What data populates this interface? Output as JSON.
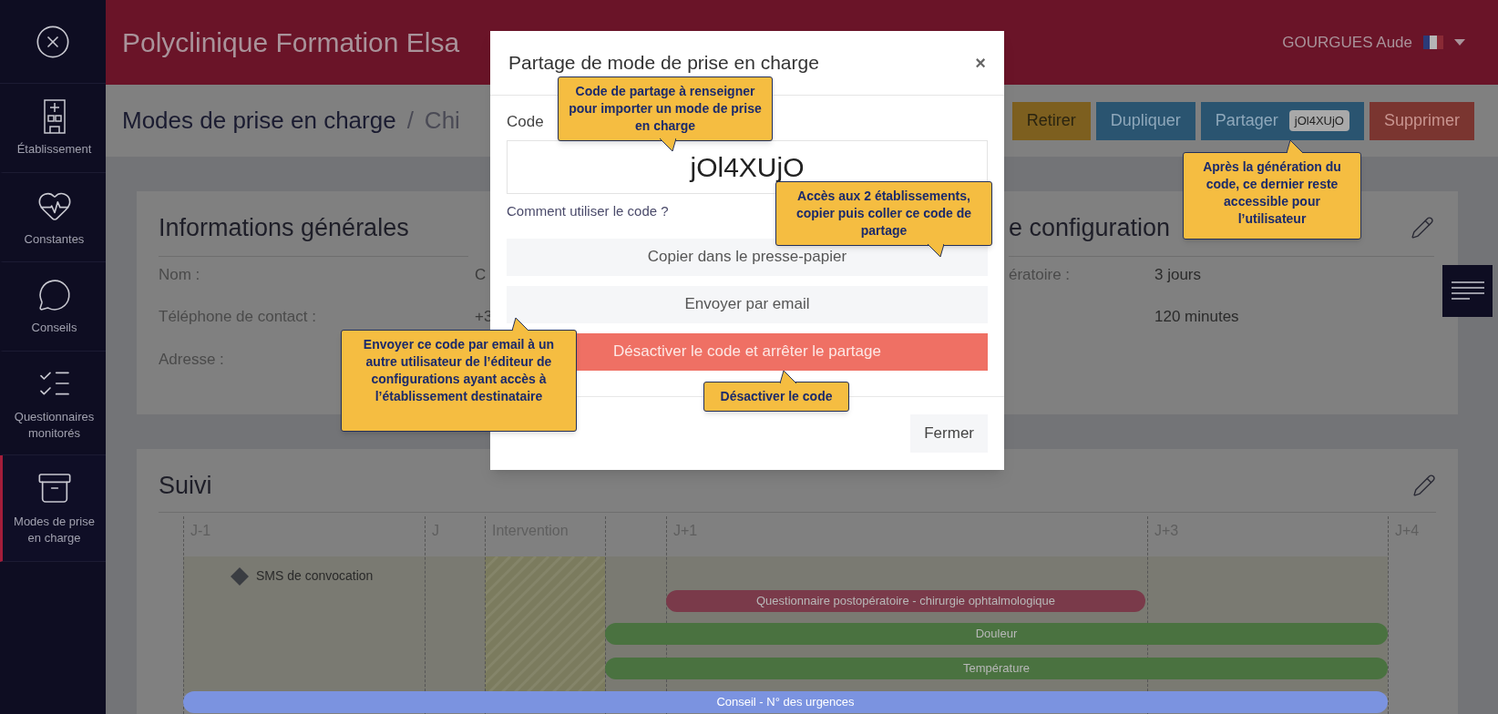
{
  "sidebar": {
    "items": [
      {
        "label": "Établissement",
        "selected": false
      },
      {
        "label": "Constantes",
        "selected": false
      },
      {
        "label": "Conseils",
        "selected": false
      },
      {
        "label": "Questionnaires monitorés",
        "selected": false
      },
      {
        "label": "Modes de prise en charge",
        "selected": true
      }
    ]
  },
  "header": {
    "title": "Polyclinique Formation Elsa",
    "user": "GOURGUES Aude"
  },
  "page": {
    "breadcrumb": [
      "Modes de prise en charge",
      "/",
      "Chi"
    ],
    "actions": [
      {
        "label": "Retirer",
        "kind": "warning"
      },
      {
        "label": "Dupliquer",
        "kind": "primary"
      },
      {
        "label": "Partager",
        "kind": "primary",
        "badge": "jOl4XUjO"
      },
      {
        "label": "Supprimer",
        "kind": "danger"
      }
    ]
  },
  "general_card": {
    "title": "Informations générales",
    "fields": [
      {
        "label": "Nom :",
        "value": "C"
      },
      {
        "label": "Téléphone de contact :",
        "value": "+3"
      },
      {
        "label": "Adresse :"
      }
    ]
  },
  "config_card": {
    "title": "e configuration",
    "fields": [
      {
        "label": "ératoire :",
        "value": "3 jours"
      },
      {
        "value": "120 minutes"
      }
    ]
  },
  "suivi": {
    "title": "Suivi",
    "columns": [
      "J-1",
      "J",
      "Intervention",
      "J+1",
      "J+3",
      "J+4"
    ],
    "milestones": [
      {
        "label": "SMS de convocation"
      }
    ],
    "bars": [
      {
        "label": "Questionnaire postopératoire - chirurgie ophtalmologique",
        "color": "#7a3a4a"
      },
      {
        "label": "Douleur",
        "color": "#4a7240"
      },
      {
        "label": "Température",
        "color": "#4a7240"
      },
      {
        "label": "Conseil - N° des urgences",
        "color": "#7b93e0"
      }
    ]
  },
  "dialog": {
    "title": "Partage de mode de prise en charge",
    "close": "×",
    "code_label": "Code",
    "code": "jOl4XUjO",
    "help_link": "Comment utiliser le code ?",
    "actions": [
      {
        "label": "Copier dans le presse-papier",
        "kind": "default"
      },
      {
        "label": "Envoyer par email",
        "kind": "default"
      },
      {
        "label": "Désactiver le code et arrêter le partage",
        "kind": "danger"
      }
    ],
    "footer_button": "Fermer"
  },
  "callouts": [
    {
      "text": "Code de partage à renseigner pour importer un mode de prise en charge"
    },
    {
      "text": "Accès aux 2 établissements, copier puis coller ce code de partage"
    },
    {
      "text": "Après la génération du code, ce dernier reste accessible pour l’utilisateur"
    },
    {
      "text": "Envoyer ce code par email à un autre utilisateur de l’éditeur de configurations ayant accès à l’établissement destinataire"
    },
    {
      "text": "Désactiver le code"
    }
  ]
}
